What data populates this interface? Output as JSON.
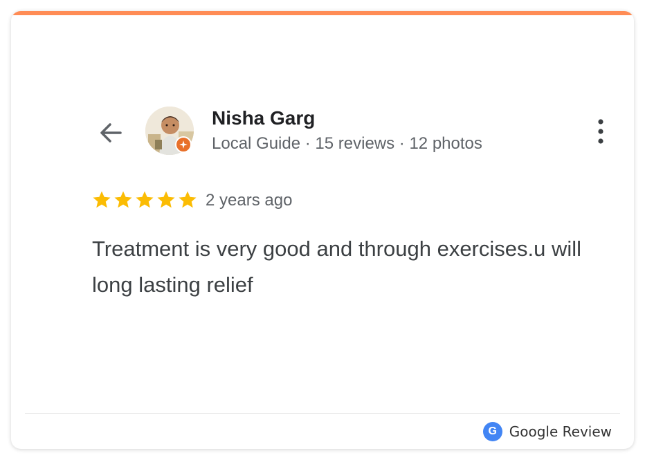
{
  "review": {
    "reviewer_name": "Nisha Garg",
    "reviewer_meta": "Local Guide · 15 reviews · 12 photos",
    "rating": 5,
    "rating_max": 5,
    "date": "2 years ago",
    "text": "Treatment is very good and through exercises.u will long lasting relief"
  },
  "footer": {
    "brand_letter": "G",
    "label": "Google Review"
  },
  "colors": {
    "accent": "#ff8c55",
    "star": "#fbbc04",
    "google_blue": "#4285f4",
    "badge": "#e8702a"
  },
  "icons": {
    "back": "arrow-left-icon",
    "menu": "more-vertical-icon",
    "star": "star-icon",
    "badge": "local-guide-badge-icon"
  }
}
